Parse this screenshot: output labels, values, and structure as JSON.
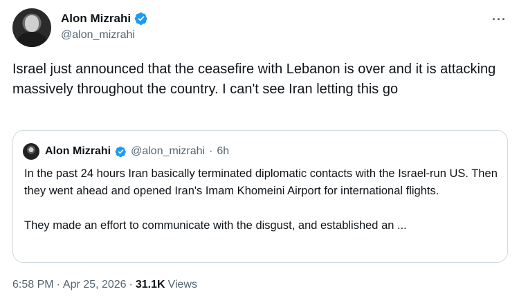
{
  "author": {
    "display_name": "Alon Mizrahi",
    "handle": "@alon_mizrahi"
  },
  "more_menu_label": "···",
  "tweet": {
    "text": "Israel just announced that the ceasefire with Lebanon is over and it is attacking massively throughout the country. I can't see Iran letting this go"
  },
  "quoted": {
    "display_name": "Alon Mizrahi",
    "handle": "@alon_mizrahi",
    "separator": "·",
    "time": "6h",
    "paragraph1": "In the past 24 hours Iran basically terminated diplomatic contacts with the Israel-run US. Then they went ahead and opened Iran's Imam Khomeini Airport for international flights.",
    "paragraph2": "They made an effort to communicate with the disgust, and established an ..."
  },
  "meta": {
    "time": "6:58 PM",
    "sep1": "·",
    "date": "Apr 25, 2026",
    "sep2": "·",
    "views_count": "31.1K",
    "views_label": "Views"
  },
  "colors": {
    "verified": "#1d9bf0",
    "text": "#0f1419",
    "secondary": "#536471",
    "border": "#cfd9de"
  },
  "icons": {
    "verified": "verified-badge-icon",
    "more": "more-horizontal-icon"
  }
}
